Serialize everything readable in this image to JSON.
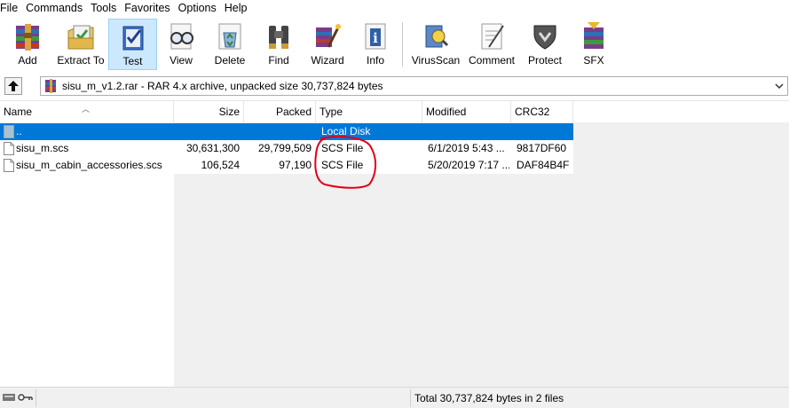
{
  "menu": [
    "File",
    "Commands",
    "Tools",
    "Favorites",
    "Options",
    "Help"
  ],
  "toolbar": {
    "add": "Add",
    "extract": "Extract To",
    "test": "Test",
    "view": "View",
    "delete": "Delete",
    "find": "Find",
    "wizard": "Wizard",
    "info": "Info",
    "virusscan": "VirusScan",
    "comment": "Comment",
    "protect": "Protect",
    "sfx": "SFX"
  },
  "address": {
    "text": "sisu_m_v1.2.rar - RAR 4.x archive, unpacked size 30,737,824 bytes"
  },
  "columns": {
    "name": "Name",
    "size": "Size",
    "packed": "Packed",
    "type": "Type",
    "modified": "Modified",
    "crc": "CRC32"
  },
  "rows": [
    {
      "name": "..",
      "size": "",
      "packed": "",
      "type": "Local Disk",
      "modified": "",
      "crc": ""
    },
    {
      "name": "sisu_m.scs",
      "size": "30,631,300",
      "packed": "29,799,509",
      "type": "SCS File",
      "modified": "6/1/2019 5:43 ...",
      "crc": "9817DF60"
    },
    {
      "name": "sisu_m_cabin_accessories.scs",
      "size": "106,524",
      "packed": "97,190",
      "type": "SCS File",
      "modified": "5/20/2019 7:17 ...",
      "crc": "DAF84B4F"
    }
  ],
  "status": {
    "text": "Total 30,737,824 bytes in 2 files"
  },
  "colors": {
    "selection": "#0078d7",
    "annotation": "#e0001a"
  }
}
